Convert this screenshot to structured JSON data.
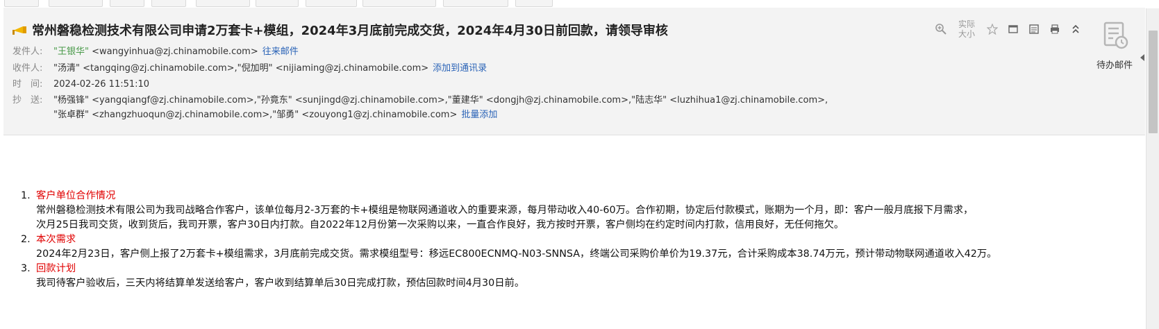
{
  "email": {
    "subject": "常州磐稳检测技术有限公司申请2万套卡+模组，2024年3月底前完成交货，2024年4月30日前回款，请领导审核",
    "from": {
      "key": "发件人:",
      "name": "\"王银华\"",
      "address": " <wangyinhua@zj.chinamobile.com>",
      "link": "往来邮件"
    },
    "to": {
      "key": "收件人:",
      "value": "\"汤清\" <tangqing@zj.chinamobile.com>,\"倪加明\" <nijiaming@zj.chinamobile.com>",
      "link": "添加到通讯录"
    },
    "time": {
      "key": "时　间:",
      "value": "2024-02-26 11:51:10"
    },
    "cc": {
      "key": "抄　送:",
      "line1": "\"杨强锋\" <yangqiangf@zj.chinamobile.com>,\"孙竟东\" <sunjingd@zj.chinamobile.com>,\"董建华\" <dongjh@zj.chinamobile.com>,\"陆志华\" <luzhihua1@zj.chinamobile.com>,",
      "line2": "\"张卓群\" <zhangzhuoqun@zj.chinamobile.com>,\"邹勇\" <zouyong1@zj.chinamobile.com>",
      "link": "批量添加"
    }
  },
  "toolbar": {
    "actual_size_line1": "实际",
    "actual_size_line2": "大小",
    "icons": [
      "zoom-in-icon",
      "star-icon",
      "window-icon",
      "print-preview-icon",
      "print-icon",
      "collapse-up-icon"
    ]
  },
  "side": {
    "todo_label": "待办邮件"
  },
  "content": {
    "items": [
      {
        "number": "1.",
        "heading": "客户单位合作情况",
        "lines": [
          "常州磐稳检测技术有限公司为我司战略合作客户，该单位每月2-3万套的卡+模组是物联网通道收入的重要来源，每月带动收入40-60万。合作初期，协定后付款模式，账期为一个月，即：客户一般月底报下月需求，",
          "次月25日我司交货，收到货后，我司开票，客户30日内打款。自2022年12月份第一次采购以来，一直合作良好，我方按时开票，客户侧均在约定时间内打款，信用良好，无任何拖欠。"
        ]
      },
      {
        "number": "2.",
        "heading": "本次需求",
        "lines": [
          "2024年2月23日，客户侧上报了2万套卡+模组需求，3月底前完成交货。需求模组型号：移远EC800ECNMQ-N03-SNNSA，终端公司采购价单价为19.37元，合计采购成本38.74万元，预计带动物联网通道收入42万。"
        ]
      },
      {
        "number": "3.",
        "heading": "回款计划",
        "lines": [
          "我司待客户验收后，三天内将结算单发送给客户，客户收到结算单后30日完成打款，预估回款时间4月30日前。"
        ]
      }
    ]
  },
  "colors": {
    "heading_red": "#e00000",
    "link_blue": "#2a63b7",
    "sender_green": "#4a9a4a",
    "header_bg": "#f3f3f3"
  }
}
